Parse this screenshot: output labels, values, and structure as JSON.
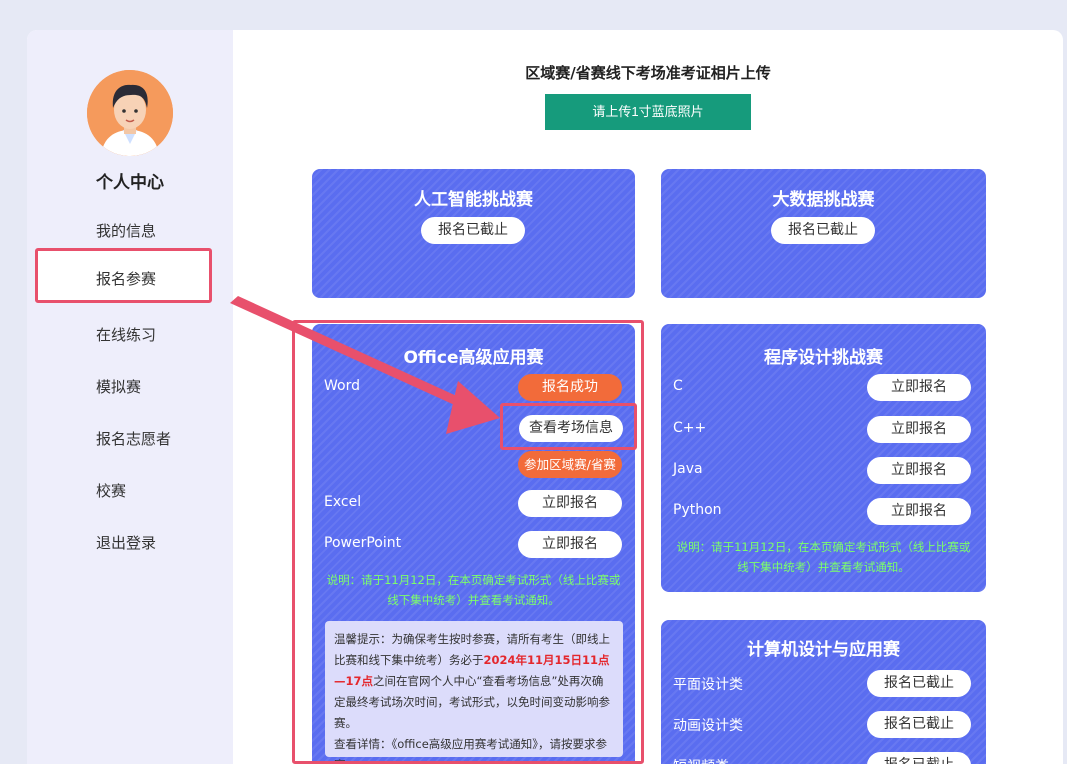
{
  "sidebar": {
    "title": "个人中心",
    "items": [
      {
        "label": "我的信息"
      },
      {
        "label": "报名参赛"
      },
      {
        "label": "在线练习"
      },
      {
        "label": "模拟赛"
      },
      {
        "label": "报名志愿者"
      },
      {
        "label": "校赛"
      },
      {
        "label": "退出登录"
      }
    ]
  },
  "upload": {
    "title": "区域赛/省赛线下考场准考证相片上传",
    "button": "请上传1寸蓝底照片"
  },
  "cards": {
    "ai": {
      "title": "人工智能挑战赛",
      "status": "报名已截止"
    },
    "bigdata": {
      "title": "大数据挑战赛",
      "status": "报名已截止"
    },
    "office": {
      "title": "Office高级应用赛",
      "word": {
        "label": "Word",
        "status": "报名成功",
        "view_info": "查看考场信息",
        "join_regional": "参加区域赛/省赛"
      },
      "excel": {
        "label": "Excel",
        "button": "立即报名"
      },
      "ppt": {
        "label": "PowerPoint",
        "button": "立即报名"
      },
      "note": "说明：请于11月12日，在本页确定考试形式（线上比赛或线下集中统考）并查看考试通知。",
      "tips": {
        "part1": "温馨提示：为确保考生按时参赛，请所有考生（即线上比赛和线下集中统考）务必于",
        "highlight": "2024年11月15日11点—17点",
        "part2": "之间在官网个人中心“查看考场信息”处再次确定最终考试场次时间，考试形式，以免时间变动影响参赛。",
        "part3": "查看详情：《office高级应用赛考试通知》，请按要求参赛。"
      }
    },
    "programming": {
      "title": "程序设计挑战赛",
      "rows": [
        {
          "label": "C",
          "button": "立即报名"
        },
        {
          "label": "C++",
          "button": "立即报名"
        },
        {
          "label": "Java",
          "button": "立即报名"
        },
        {
          "label": "Python",
          "button": "立即报名"
        }
      ],
      "note": "说明：请于11月12日，在本页确定考试形式（线上比赛或线下集中统考）并查看考试通知。"
    },
    "design": {
      "title": "计算机设计与应用赛",
      "rows": [
        {
          "label": "平面设计类",
          "button": "报名已截止"
        },
        {
          "label": "动画设计类",
          "button": "报名已截止"
        },
        {
          "label": "短视频类",
          "button": "报名已截止"
        }
      ]
    }
  },
  "colors": {
    "accent_card": "#5a6df0",
    "highlight": "#e8506c",
    "upload_btn": "#169b7c",
    "success": "#f26b3a",
    "note": "#7cff6a"
  }
}
